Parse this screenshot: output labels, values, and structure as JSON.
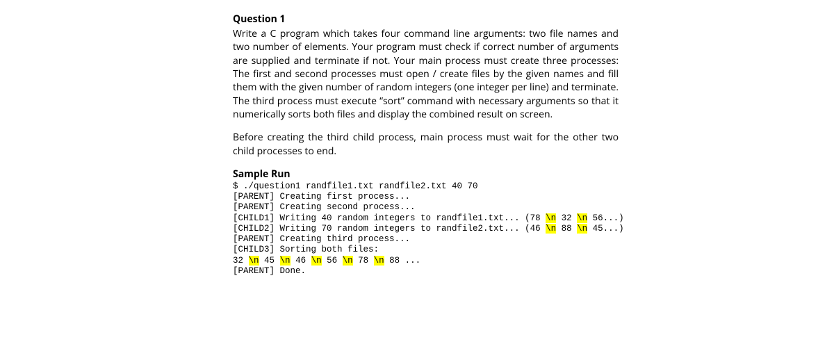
{
  "title": "Question 1",
  "body1": "Write a C program which takes four command line arguments: two file names and two number of elements. Your program must check if correct number of arguments are supplied and terminate if not. Your main process must create three processes: The first and second processes must open / create files by the given names and fill them with the given number of random integers (one integer per line) and terminate. The third process must execute “sort” command with necessary arguments so that it numerically sorts both files and display the combined result on screen.",
  "body2": "Before creating the third child process, main process must wait for the other two child processes to end.",
  "sample_title": "Sample Run",
  "run": {
    "l1": "$ ./question1 randfile1.txt randfile2.txt 40 70",
    "l2": "[PARENT] Creating first process...",
    "l3": "[PARENT] Creating second process...",
    "l4a": "[CHILD1] Writing 40 random integers to randfile1.txt... (78 ",
    "l4b": " 32 ",
    "l4c": " 56...)",
    "l5a": "[CHILD2] Writing 70 random integers to randfile2.txt... (46 ",
    "l5b": " 88 ",
    "l5c": " 45...)",
    "l6": "[PARENT] Creating third process...",
    "l7": "[CHILD3] Sorting both files:",
    "l8a": "32 ",
    "l8b": " 45 ",
    "l8c": " 46 ",
    "l8d": " 56 ",
    "l8e": " 78 ",
    "l8f": " 88 ...",
    "l9": "[PARENT] Done.",
    "nl": "\\n"
  }
}
